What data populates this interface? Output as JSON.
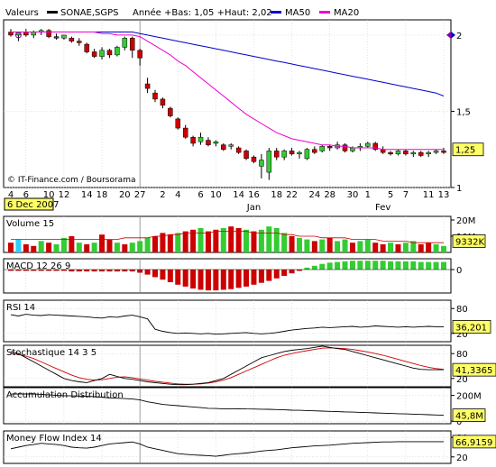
{
  "header": {
    "label": "Valeurs",
    "symbol": "SONAE,SGPS",
    "period": "Année +Bas: 1,05 +Haut: 2,02",
    "ma50_label": "MA50",
    "ma20_label": "MA20"
  },
  "colors": {
    "up": "#33cc33",
    "down": "#cc0000",
    "ma50": "#0000cc",
    "ma20": "#ee00cc",
    "grid": "#c8c8c8",
    "valbox": "#ffff66",
    "frame": "#000000",
    "highlight": "#33ccff"
  },
  "credit": "© IT-Finance.com / Boursorama",
  "date_tooltip": "6 Dec 2007",
  "x_axis": {
    "ticks": [
      "4",
      "6",
      "10",
      "12",
      "14",
      "18",
      "20",
      "27",
      "2",
      "4",
      "6",
      "10",
      "14",
      "16",
      "18",
      "22",
      "24",
      "28",
      "30",
      "1",
      "5",
      "7",
      "11",
      "13"
    ],
    "months": [
      "Dec",
      "Jan",
      "Fev"
    ]
  },
  "chart_data": [
    {
      "type": "candlestick",
      "title": "Price",
      "ylim": [
        1.0,
        2.1
      ],
      "yticks": [
        "2",
        "1,5",
        "1"
      ],
      "last_value": "1,25",
      "candles": [
        [
          2.02,
          2.04,
          1.99,
          2.0
        ],
        [
          2.0,
          2.02,
          1.96,
          2.02
        ],
        [
          2.02,
          2.04,
          1.99,
          2.0
        ],
        [
          2.0,
          2.03,
          1.98,
          2.02
        ],
        [
          2.02,
          2.04,
          2.0,
          2.03
        ],
        [
          2.03,
          2.04,
          1.98,
          1.99
        ],
        [
          1.99,
          2.01,
          1.97,
          1.98
        ],
        [
          1.98,
          2.0,
          1.97,
          2.0
        ],
        [
          1.98,
          1.99,
          1.95,
          1.96
        ],
        [
          1.96,
          1.98,
          1.93,
          1.95
        ],
        [
          1.94,
          1.95,
          1.88,
          1.89
        ],
        [
          1.89,
          1.91,
          1.85,
          1.86
        ],
        [
          1.86,
          1.92,
          1.84,
          1.9
        ],
        [
          1.9,
          1.91,
          1.85,
          1.87
        ],
        [
          1.87,
          1.93,
          1.86,
          1.92
        ],
        [
          1.92,
          1.99,
          1.9,
          1.98
        ],
        [
          1.98,
          1.99,
          1.85,
          1.9
        ],
        [
          1.9,
          1.91,
          1.8,
          1.85
        ],
        [
          1.68,
          1.72,
          1.62,
          1.65
        ],
        [
          1.62,
          1.64,
          1.56,
          1.58
        ],
        [
          1.58,
          1.59,
          1.52,
          1.54
        ],
        [
          1.52,
          1.53,
          1.46,
          1.47
        ],
        [
          1.45,
          1.46,
          1.38,
          1.39
        ],
        [
          1.39,
          1.41,
          1.32,
          1.33
        ],
        [
          1.33,
          1.34,
          1.27,
          1.29
        ],
        [
          1.3,
          1.36,
          1.28,
          1.33
        ],
        [
          1.31,
          1.33,
          1.27,
          1.28
        ],
        [
          1.29,
          1.31,
          1.27,
          1.3
        ],
        [
          1.28,
          1.29,
          1.24,
          1.25
        ],
        [
          1.27,
          1.29,
          1.25,
          1.28
        ],
        [
          1.26,
          1.27,
          1.22,
          1.23
        ],
        [
          1.24,
          1.25,
          1.18,
          1.19
        ],
        [
          1.2,
          1.21,
          1.16,
          1.17
        ],
        [
          1.14,
          1.22,
          1.06,
          1.18
        ],
        [
          1.1,
          1.26,
          1.05,
          1.24
        ],
        [
          1.24,
          1.26,
          1.18,
          1.2
        ],
        [
          1.2,
          1.25,
          1.18,
          1.24
        ],
        [
          1.24,
          1.26,
          1.21,
          1.22
        ],
        [
          1.22,
          1.24,
          1.19,
          1.23
        ],
        [
          1.19,
          1.26,
          1.18,
          1.25
        ],
        [
          1.25,
          1.27,
          1.22,
          1.23
        ],
        [
          1.24,
          1.28,
          1.23,
          1.27
        ],
        [
          1.27,
          1.28,
          1.24,
          1.26
        ],
        [
          1.26,
          1.3,
          1.25,
          1.28
        ],
        [
          1.28,
          1.29,
          1.23,
          1.24
        ],
        [
          1.24,
          1.27,
          1.23,
          1.26
        ],
        [
          1.26,
          1.29,
          1.24,
          1.27
        ],
        [
          1.27,
          1.3,
          1.26,
          1.29
        ],
        [
          1.29,
          1.3,
          1.24,
          1.25
        ],
        [
          1.25,
          1.27,
          1.22,
          1.23
        ],
        [
          1.23,
          1.24,
          1.21,
          1.22
        ],
        [
          1.22,
          1.25,
          1.21,
          1.24
        ],
        [
          1.24,
          1.25,
          1.21,
          1.22
        ],
        [
          1.22,
          1.24,
          1.2,
          1.23
        ],
        [
          1.23,
          1.24,
          1.2,
          1.21
        ],
        [
          1.22,
          1.24,
          1.2,
          1.23
        ],
        [
          1.23,
          1.25,
          1.22,
          1.24
        ],
        [
          1.24,
          1.26,
          1.22,
          1.23
        ]
      ],
      "ma50": [
        2.02,
        2.02,
        2.02,
        2.02,
        2.02,
        2.02,
        2.02,
        2.02,
        2.02,
        2.02,
        2.02,
        2.02,
        2.02,
        2.02,
        2.02,
        2.02,
        2.02,
        2.01,
        2.0,
        1.99,
        1.98,
        1.97,
        1.96,
        1.95,
        1.94,
        1.93,
        1.92,
        1.91,
        1.9,
        1.89,
        1.88,
        1.87,
        1.86,
        1.85,
        1.84,
        1.83,
        1.82,
        1.81,
        1.8,
        1.79,
        1.78,
        1.77,
        1.76,
        1.75,
        1.74,
        1.73,
        1.72,
        1.71,
        1.7,
        1.69,
        1.68,
        1.67,
        1.66,
        1.65,
        1.64,
        1.63,
        1.62,
        1.6
      ],
      "ma20": [
        2.02,
        2.02,
        2.02,
        2.02,
        2.02,
        2.02,
        2.02,
        2.02,
        2.02,
        2.02,
        2.02,
        2.02,
        2.01,
        2.01,
        2.0,
        2.0,
        2.0,
        1.99,
        1.96,
        1.93,
        1.9,
        1.87,
        1.83,
        1.8,
        1.76,
        1.72,
        1.68,
        1.64,
        1.6,
        1.56,
        1.52,
        1.48,
        1.45,
        1.42,
        1.39,
        1.36,
        1.34,
        1.32,
        1.31,
        1.3,
        1.29,
        1.28,
        1.28,
        1.27,
        1.27,
        1.26,
        1.26,
        1.26,
        1.26,
        1.25,
        1.25,
        1.25,
        1.25,
        1.25,
        1.25,
        1.25,
        1.25,
        1.25
      ]
    },
    {
      "type": "bar",
      "title": "Volume 15",
      "yticks": [
        "20M",
        "10M"
      ],
      "last_value": "9332K",
      "values": [
        6,
        8,
        5,
        4,
        7,
        6,
        5,
        9,
        10,
        6,
        5,
        6,
        11,
        8,
        6,
        5,
        6,
        7,
        9,
        10,
        12,
        11,
        12,
        13,
        14,
        15,
        13,
        14,
        15,
        16,
        15,
        14,
        13,
        14,
        16,
        15,
        12,
        10,
        9,
        8,
        7,
        8,
        9,
        7,
        8,
        6,
        7,
        8,
        6,
        5,
        6,
        5,
        6,
        7,
        5,
        6,
        5,
        4
      ],
      "up_flags": [
        0,
        1,
        0,
        0,
        1,
        0,
        1,
        1,
        0,
        1,
        0,
        1,
        0,
        0,
        1,
        0,
        1,
        1,
        1,
        0,
        0,
        0,
        1,
        0,
        0,
        1,
        0,
        0,
        1,
        0,
        0,
        1,
        0,
        1,
        1,
        1,
        1,
        0,
        1,
        1,
        0,
        1,
        0,
        1,
        1,
        0,
        1,
        1,
        0,
        0,
        1,
        0,
        1,
        1,
        0,
        0,
        1,
        1
      ],
      "highlight_index": 1,
      "ma_line": [
        8,
        8,
        8,
        8,
        8,
        8,
        8,
        8,
        8,
        8,
        8,
        8,
        8,
        8,
        8,
        9,
        9,
        9,
        9,
        10,
        10,
        11,
        11,
        12,
        12,
        12,
        12,
        13,
        13,
        13,
        13,
        13,
        12,
        12,
        12,
        12,
        11,
        11,
        10,
        10,
        10,
        9,
        9,
        9,
        9,
        8,
        8,
        8,
        8,
        7,
        7,
        7,
        7,
        6,
        6,
        6,
        6,
        6
      ]
    },
    {
      "type": "histogram",
      "title": "MACD 12 26 9",
      "yticks": [
        "0"
      ],
      "values": [
        -0.02,
        -0.02,
        -0.02,
        -0.02,
        -0.02,
        -0.02,
        -0.02,
        -0.02,
        -0.03,
        -0.03,
        -0.03,
        -0.03,
        -0.03,
        -0.03,
        -0.03,
        -0.03,
        -0.03,
        -0.05,
        -0.08,
        -0.12,
        -0.16,
        -0.2,
        -0.24,
        -0.27,
        -0.3,
        -0.32,
        -0.33,
        -0.33,
        -0.32,
        -0.31,
        -0.29,
        -0.27,
        -0.24,
        -0.21,
        -0.18,
        -0.14,
        -0.1,
        -0.06,
        -0.02,
        0.03,
        0.06,
        0.09,
        0.11,
        0.12,
        0.13,
        0.14,
        0.14,
        0.14,
        0.14,
        0.14,
        0.13,
        0.13,
        0.13,
        0.13,
        0.12,
        0.12,
        0.12,
        0.12
      ]
    },
    {
      "type": "line",
      "title": "RSI 14",
      "yticks": [
        "80",
        "20"
      ],
      "last_value": "36,201",
      "values": [
        65,
        62,
        66,
        64,
        63,
        65,
        64,
        63,
        62,
        61,
        60,
        58,
        57,
        60,
        59,
        62,
        64,
        60,
        55,
        30,
        25,
        22,
        20,
        21,
        20,
        19,
        20,
        18,
        19,
        20,
        21,
        22,
        20,
        19,
        20,
        22,
        25,
        28,
        30,
        32,
        33,
        35,
        34,
        35,
        36,
        37,
        35,
        36,
        38,
        37,
        36,
        35,
        36,
        35,
        36,
        37,
        36,
        36
      ]
    },
    {
      "type": "line",
      "title": "Stochastique 14 3 5",
      "yticks": [
        "80",
        "20"
      ],
      "last_value": "41,3365",
      "values": [
        85,
        80,
        70,
        60,
        50,
        40,
        30,
        20,
        15,
        12,
        10,
        15,
        20,
        30,
        25,
        20,
        18,
        15,
        12,
        10,
        8,
        6,
        5,
        5,
        6,
        8,
        10,
        15,
        20,
        30,
        40,
        50,
        60,
        70,
        75,
        80,
        85,
        88,
        90,
        92,
        95,
        98,
        95,
        92,
        90,
        85,
        80,
        75,
        70,
        65,
        60,
        55,
        50,
        45,
        42,
        41,
        41,
        41
      ],
      "signal": [
        80,
        78,
        74,
        68,
        60,
        52,
        44,
        36,
        28,
        22,
        18,
        16,
        17,
        20,
        23,
        24,
        22,
        19,
        16,
        13,
        11,
        9,
        7,
        6,
        6,
        7,
        9,
        12,
        16,
        22,
        30,
        38,
        46,
        54,
        62,
        70,
        76,
        80,
        84,
        87,
        90,
        93,
        94,
        93,
        92,
        90,
        87,
        84,
        80,
        76,
        71,
        66,
        61,
        56,
        51,
        47,
        44,
        42
      ]
    },
    {
      "type": "line",
      "title": "Accumulation Distribution",
      "yticks": [
        "200M",
        "0"
      ],
      "last_value": "45,8M",
      "values": [
        210,
        210,
        212,
        210,
        208,
        205,
        200,
        198,
        196,
        195,
        193,
        190,
        185,
        180,
        178,
        175,
        172,
        165,
        150,
        140,
        130,
        125,
        120,
        115,
        110,
        105,
        100,
        98,
        95,
        96,
        97,
        95,
        94,
        93,
        92,
        90,
        88,
        85,
        84,
        82,
        80,
        78,
        76,
        74,
        72,
        70,
        68,
        66,
        64,
        62,
        60,
        58,
        56,
        54,
        52,
        50,
        48,
        46
      ]
    },
    {
      "type": "line",
      "title": "Money Flow Index 14",
      "yticks": [
        "80",
        "20"
      ],
      "last_value": "66,9159",
      "values": [
        45,
        50,
        55,
        58,
        62,
        60,
        58,
        55,
        50,
        48,
        47,
        50,
        55,
        60,
        62,
        64,
        66,
        60,
        50,
        45,
        40,
        35,
        30,
        28,
        26,
        25,
        24,
        22,
        25,
        28,
        30,
        32,
        35,
        38,
        40,
        42,
        45,
        48,
        50,
        52,
        54,
        55,
        56,
        58,
        60,
        62,
        63,
        64,
        65,
        66,
        66,
        67,
        67,
        67,
        67,
        67,
        67,
        67
      ]
    }
  ]
}
